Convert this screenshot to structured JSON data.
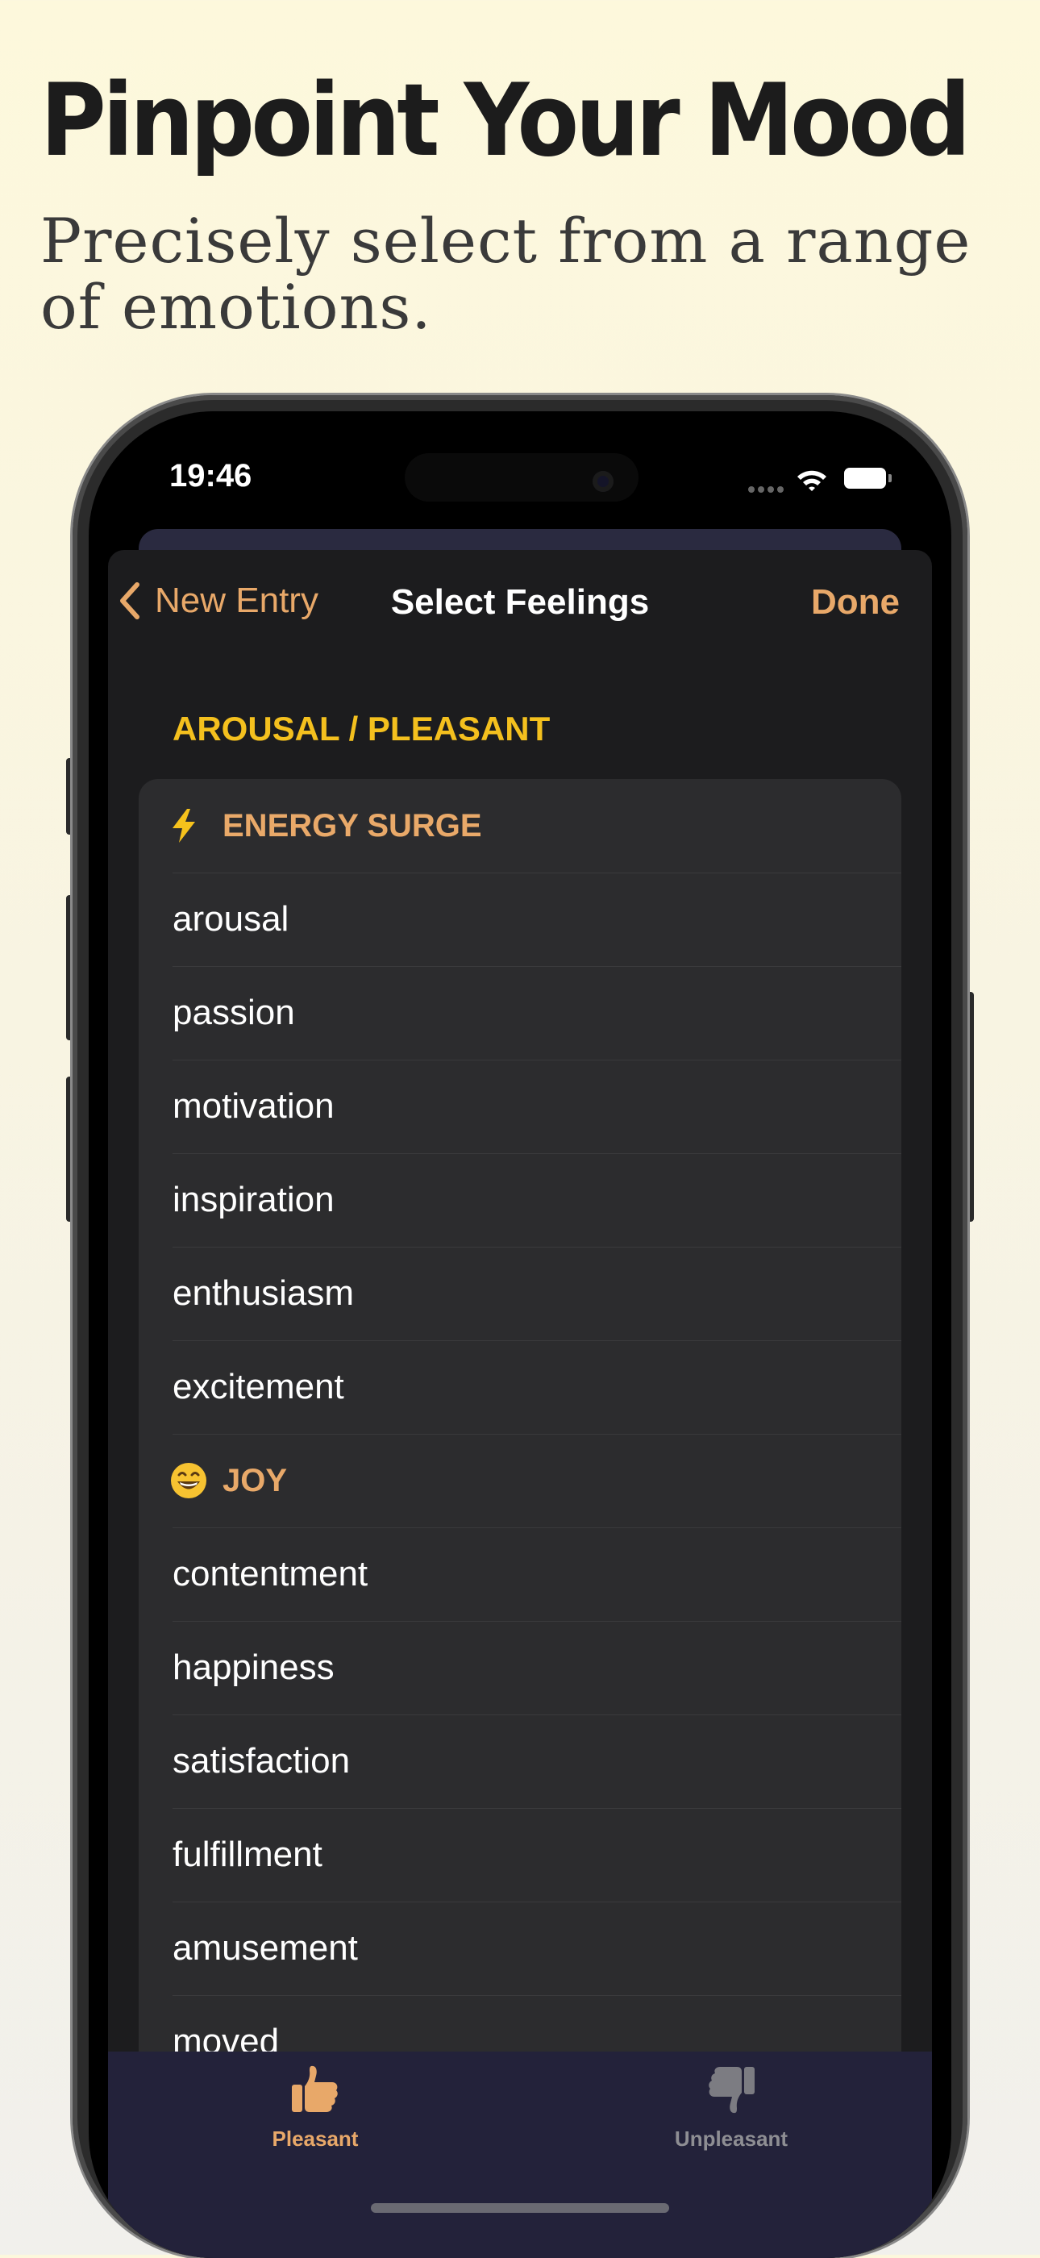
{
  "headline": "Pinpoint Your Mood",
  "subheadline": "Precisely select from a range of emotions.",
  "status_bar": {
    "time": "19:46"
  },
  "nav": {
    "back_label": "New Entry",
    "title": "Select Feelings",
    "done_label": "Done"
  },
  "section": {
    "title": "AROUSAL / PLEASANT",
    "groups": [
      {
        "icon": "lightning-bolt-icon",
        "title": "ENERGY SURGE",
        "items": [
          "arousal",
          "passion",
          "motivation",
          "inspiration",
          "enthusiasm",
          "excitement"
        ]
      },
      {
        "icon": "grinning-face-icon",
        "title": "JOY",
        "items": [
          "contentment",
          "happiness",
          "satisfaction",
          "fulfillment",
          "amusement",
          "moved"
        ]
      }
    ]
  },
  "tabs": [
    {
      "label": "Pleasant",
      "icon": "thumbs-up-icon",
      "selected": true,
      "color": "#e8a869"
    },
    {
      "label": "Unpleasant",
      "icon": "thumbs-down-icon",
      "selected": false,
      "color": "#8e8e93"
    }
  ],
  "colors": {
    "accent": "#e8a869",
    "section_header": "#f4c01e",
    "sheet_background": "#1c1c1e",
    "list_background": "#2c2c2e",
    "tabbar_background": "#23223a"
  }
}
